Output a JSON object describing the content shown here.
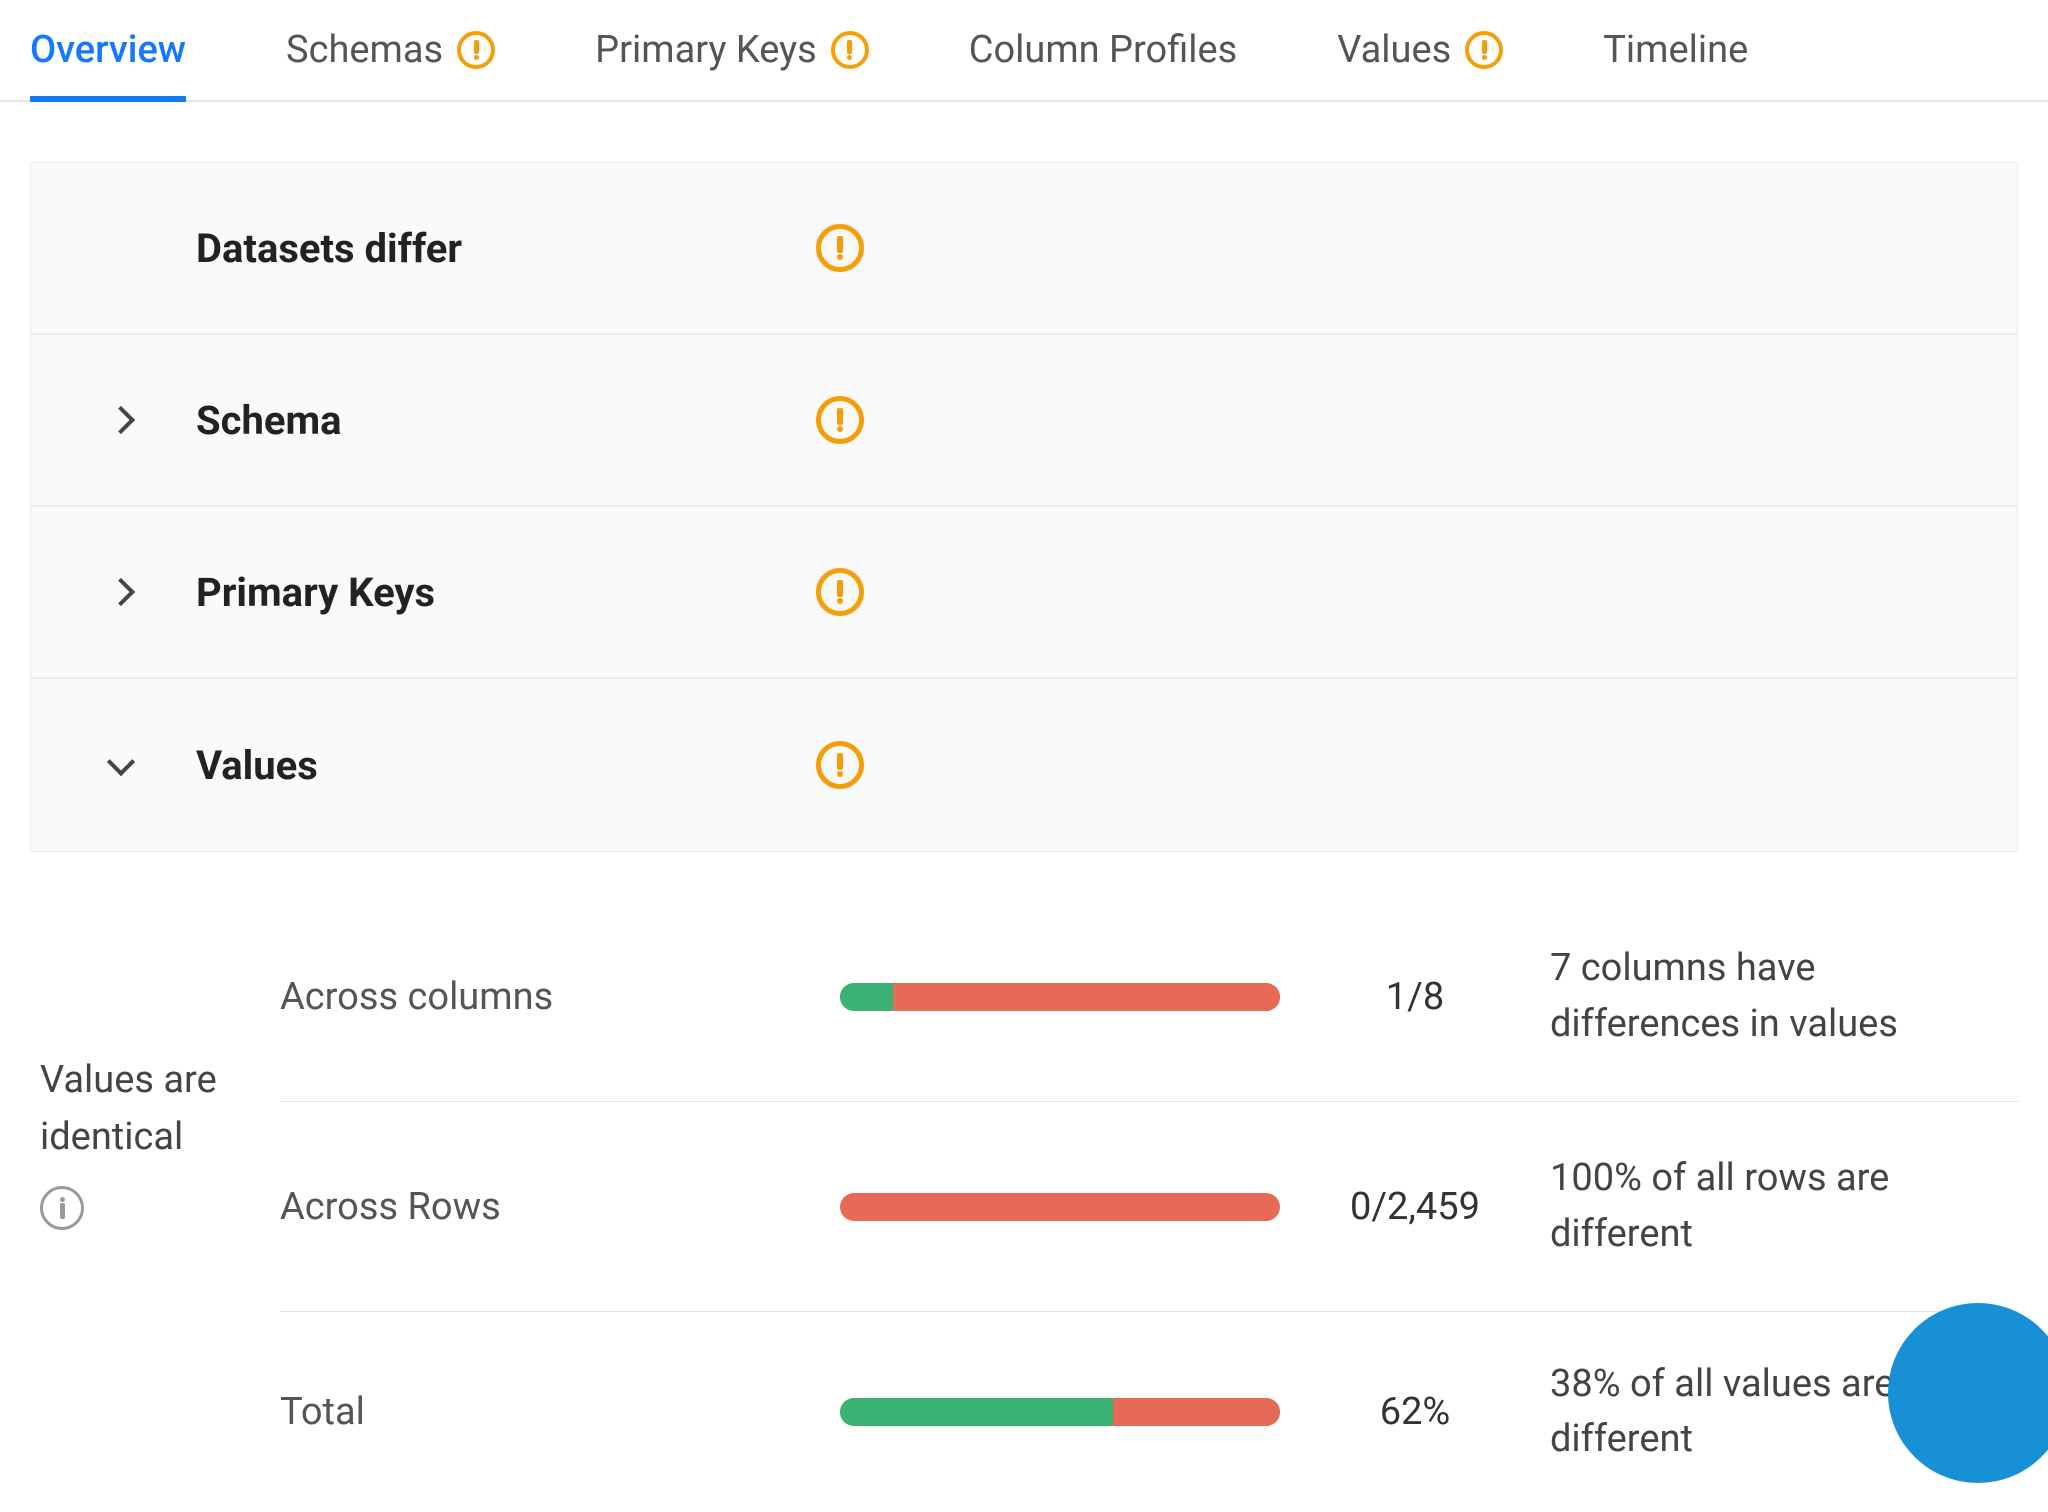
{
  "tabs": [
    {
      "label": "Overview",
      "warning": false,
      "active": true
    },
    {
      "label": "Schemas",
      "warning": true,
      "active": false
    },
    {
      "label": "Primary Keys",
      "warning": true,
      "active": false
    },
    {
      "label": "Column Profiles",
      "warning": false,
      "active": false
    },
    {
      "label": "Values",
      "warning": true,
      "active": false
    },
    {
      "label": "Timeline",
      "warning": false,
      "active": false
    }
  ],
  "summary": [
    {
      "label": "Datasets differ",
      "chevron": "none",
      "warning": true
    },
    {
      "label": "Schema",
      "chevron": "right",
      "warning": true
    },
    {
      "label": "Primary Keys",
      "chevron": "right",
      "warning": true
    },
    {
      "label": "Values",
      "chevron": "down",
      "warning": true
    }
  ],
  "values_section": {
    "side_label": "Values are identical",
    "metrics": [
      {
        "label": "Across columns",
        "green_pct": 12,
        "value": "1/8",
        "desc": "7 columns have differences in values"
      },
      {
        "label": "Across Rows",
        "green_pct": 0,
        "value": "0/2,459",
        "desc": "100% of all rows are different"
      },
      {
        "label": "Total",
        "green_pct": 62,
        "value": "62%",
        "desc": "38% of all values are different"
      }
    ]
  },
  "chart_data": [
    {
      "type": "bar",
      "title": "Across columns - values identical",
      "categories": [
        "identical",
        "different"
      ],
      "values": [
        1,
        7
      ],
      "note": "1/8"
    },
    {
      "type": "bar",
      "title": "Across Rows - values identical",
      "categories": [
        "identical",
        "different"
      ],
      "values": [
        0,
        2459
      ],
      "note": "0/2,459"
    },
    {
      "type": "bar",
      "title": "Total - values identical",
      "categories": [
        "identical_pct",
        "different_pct"
      ],
      "values": [
        62,
        38
      ],
      "note": "62%"
    }
  ]
}
